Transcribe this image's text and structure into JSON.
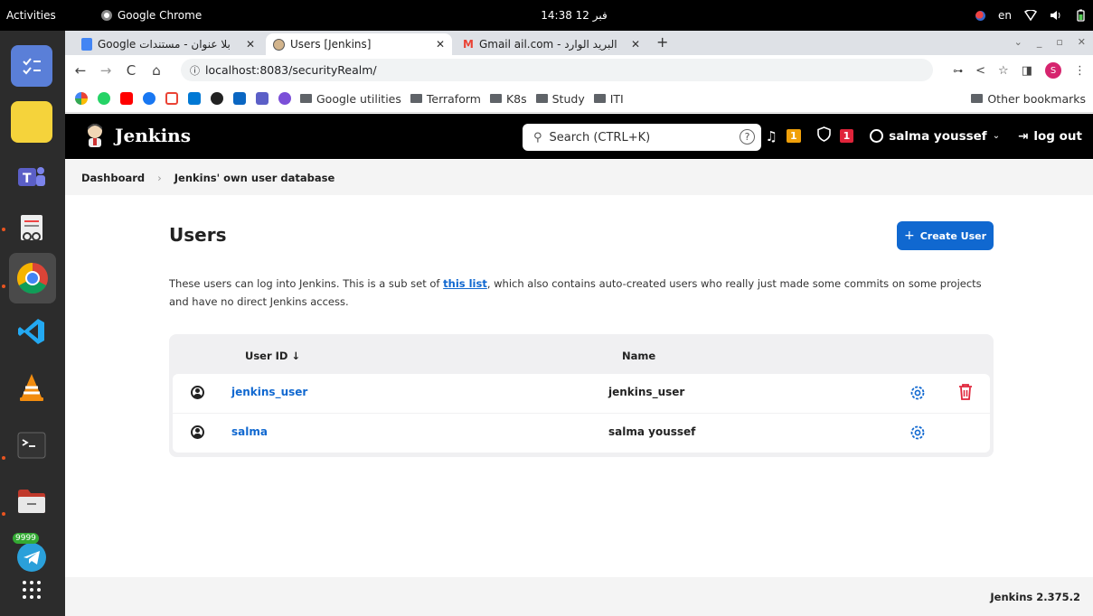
{
  "topbar": {
    "activities": "Activities",
    "app_name": "Google Chrome",
    "clock": "فبر 12  14:38",
    "lang": "en"
  },
  "dock": {
    "telegram_badge": "9999"
  },
  "tabs": [
    {
      "label": "بلا عنوان - مستندات Google"
    },
    {
      "label": "Users [Jenkins]"
    },
    {
      "label": "البريد الوارد - Gmail ail.com"
    }
  ],
  "address": {
    "url": "localhost:8083/securityRealm/"
  },
  "bookmarks": {
    "folders": [
      "Google utilities",
      "Terraform",
      "K8s",
      "Study",
      "ITI"
    ],
    "other": "Other bookmarks",
    "profile_initial": "S"
  },
  "jenkins": {
    "title": "Jenkins",
    "search_placeholder": "Search (CTRL+K)",
    "notif_count": "1",
    "security_count": "1",
    "user": "salma youssef",
    "logout": "log out"
  },
  "breadcrumb": {
    "dashboard": "Dashboard",
    "current": "Jenkins' own user database"
  },
  "page": {
    "title": "Users",
    "create_button": "Create User",
    "desc_before": "These users can log into Jenkins. This is a sub set of ",
    "desc_link": "this list",
    "desc_after": ", which also contains auto-created users who really just made some commits on some projects and have no direct Jenkins access."
  },
  "table": {
    "col_user_id": "User ID  ↓",
    "col_name": "Name",
    "rows": [
      {
        "user_id": "jenkins_user",
        "name": "jenkins_user"
      },
      {
        "user_id": "salma",
        "name": "salma youssef"
      }
    ]
  },
  "footer": {
    "version": "Jenkins 2.375.2"
  },
  "colors": {
    "accent": "#1068d0",
    "danger": "#e0243a",
    "warning": "#f0a00a"
  }
}
